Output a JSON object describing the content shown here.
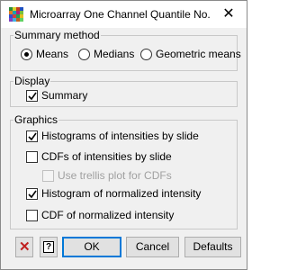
{
  "window": {
    "title": "Microarray One Channel Quantile No...",
    "close_glyph": "✕",
    "app_icon_colors": [
      "#2a8c3c",
      "#d9d12a",
      "#c43a1f",
      "#1f4fbf",
      "#e07a1f",
      "#1aa0b0",
      "#b0207a",
      "#7ac03a",
      "#3050d0",
      "#d04040",
      "#20a050",
      "#e0c020",
      "#8040c0",
      "#40b0e0",
      "#c06020",
      "#60d060"
    ]
  },
  "summary_method": {
    "label": "Summary method",
    "options": [
      {
        "label": "Means",
        "selected": true
      },
      {
        "label": "Medians",
        "selected": false
      },
      {
        "label": "Geometric means",
        "selected": false
      }
    ]
  },
  "display": {
    "label": "Display",
    "summary": {
      "label": "Summary",
      "checked": true
    }
  },
  "graphics": {
    "label": "Graphics",
    "histograms": {
      "label": "Histograms of intensities by slide",
      "checked": true
    },
    "cdfs": {
      "label": "CDFs of intensities by slide",
      "checked": false
    },
    "trellis": {
      "label": "Use trellis plot for CDFs",
      "checked": false,
      "disabled": true
    },
    "histogram_norm": {
      "label": "Histogram of normalized intensity",
      "checked": true
    },
    "cdf_norm": {
      "label": "CDF of normalized intensity",
      "checked": false
    }
  },
  "buttons": {
    "clear_icon": "✕",
    "help_icon": "?",
    "ok": "OK",
    "cancel": "Cancel",
    "defaults": "Defaults"
  }
}
